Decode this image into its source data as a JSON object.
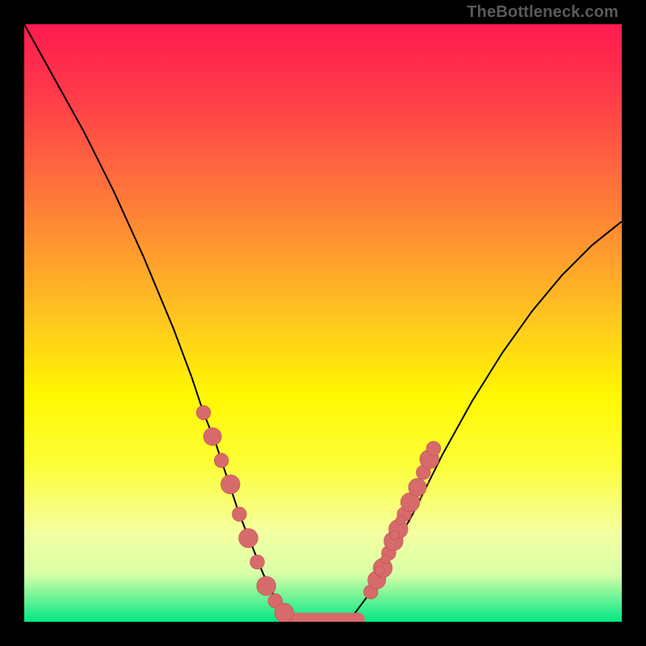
{
  "watermark_text": "TheBottleneck.com",
  "colors": {
    "frame": "#000000",
    "curve": "#000000",
    "marker_fill": "#d76a6a",
    "marker_stroke": "#c05050"
  },
  "chart_data": {
    "type": "line",
    "title": "",
    "xlabel": "",
    "ylabel": "",
    "xlim": [
      0,
      100
    ],
    "ylim": [
      0,
      100
    ],
    "grid": false,
    "legend": false,
    "annotations": [
      "TheBottleneck.com"
    ],
    "series": [
      {
        "name": "curve",
        "x": [
          0,
          5,
          10,
          15,
          20,
          25,
          28,
          30,
          32,
          34,
          36,
          38,
          40,
          42,
          45,
          48,
          50,
          52,
          55,
          58,
          60,
          65,
          70,
          75,
          80,
          85,
          90,
          95,
          100
        ],
        "y": [
          100,
          91,
          82,
          72,
          61,
          49,
          41,
          35,
          30,
          24,
          18,
          13,
          8,
          4,
          1,
          0,
          0,
          0,
          1,
          5,
          9,
          18,
          28,
          37,
          45,
          52,
          58,
          63,
          67
        ]
      }
    ],
    "markers": [
      {
        "x": 30,
        "y": 35,
        "r": 1.2
      },
      {
        "x": 31.5,
        "y": 31,
        "r": 1.5
      },
      {
        "x": 33,
        "y": 27,
        "r": 1.2
      },
      {
        "x": 34.5,
        "y": 23,
        "r": 1.6
      },
      {
        "x": 36,
        "y": 18,
        "r": 1.2
      },
      {
        "x": 37.5,
        "y": 14,
        "r": 1.6
      },
      {
        "x": 39,
        "y": 10,
        "r": 1.2
      },
      {
        "x": 40.5,
        "y": 6,
        "r": 1.6
      },
      {
        "x": 42,
        "y": 3.5,
        "r": 1.2
      },
      {
        "x": 43.5,
        "y": 1.5,
        "r": 1.6
      },
      {
        "x": 58,
        "y": 5,
        "r": 1.2
      },
      {
        "x": 59,
        "y": 7,
        "r": 1.5
      },
      {
        "x": 60,
        "y": 9,
        "r": 1.6
      },
      {
        "x": 61,
        "y": 11.5,
        "r": 1.2
      },
      {
        "x": 61.8,
        "y": 13.5,
        "r": 1.6
      },
      {
        "x": 62.6,
        "y": 15.5,
        "r": 1.6
      },
      {
        "x": 63.6,
        "y": 18,
        "r": 1.2
      },
      {
        "x": 64.6,
        "y": 20,
        "r": 1.6
      },
      {
        "x": 65.8,
        "y": 22.5,
        "r": 1.5
      },
      {
        "x": 66.8,
        "y": 25,
        "r": 1.2
      },
      {
        "x": 67.8,
        "y": 27.2,
        "r": 1.6
      },
      {
        "x": 68.5,
        "y": 29,
        "r": 1.2
      },
      {
        "x": 59.5,
        "y": 8.5,
        "r": 0.8
      },
      {
        "x": 60.5,
        "y": 10.5,
        "r": 0.8
      },
      {
        "x": 62,
        "y": 14.5,
        "r": 0.8
      },
      {
        "x": 63,
        "y": 17,
        "r": 0.8
      }
    ],
    "flat_bottom": {
      "x_start": 44,
      "x_end": 57,
      "y": 0.4,
      "thickness": 2.2
    },
    "rough_texture_right": {
      "x_start": 58,
      "x_end": 68
    }
  }
}
